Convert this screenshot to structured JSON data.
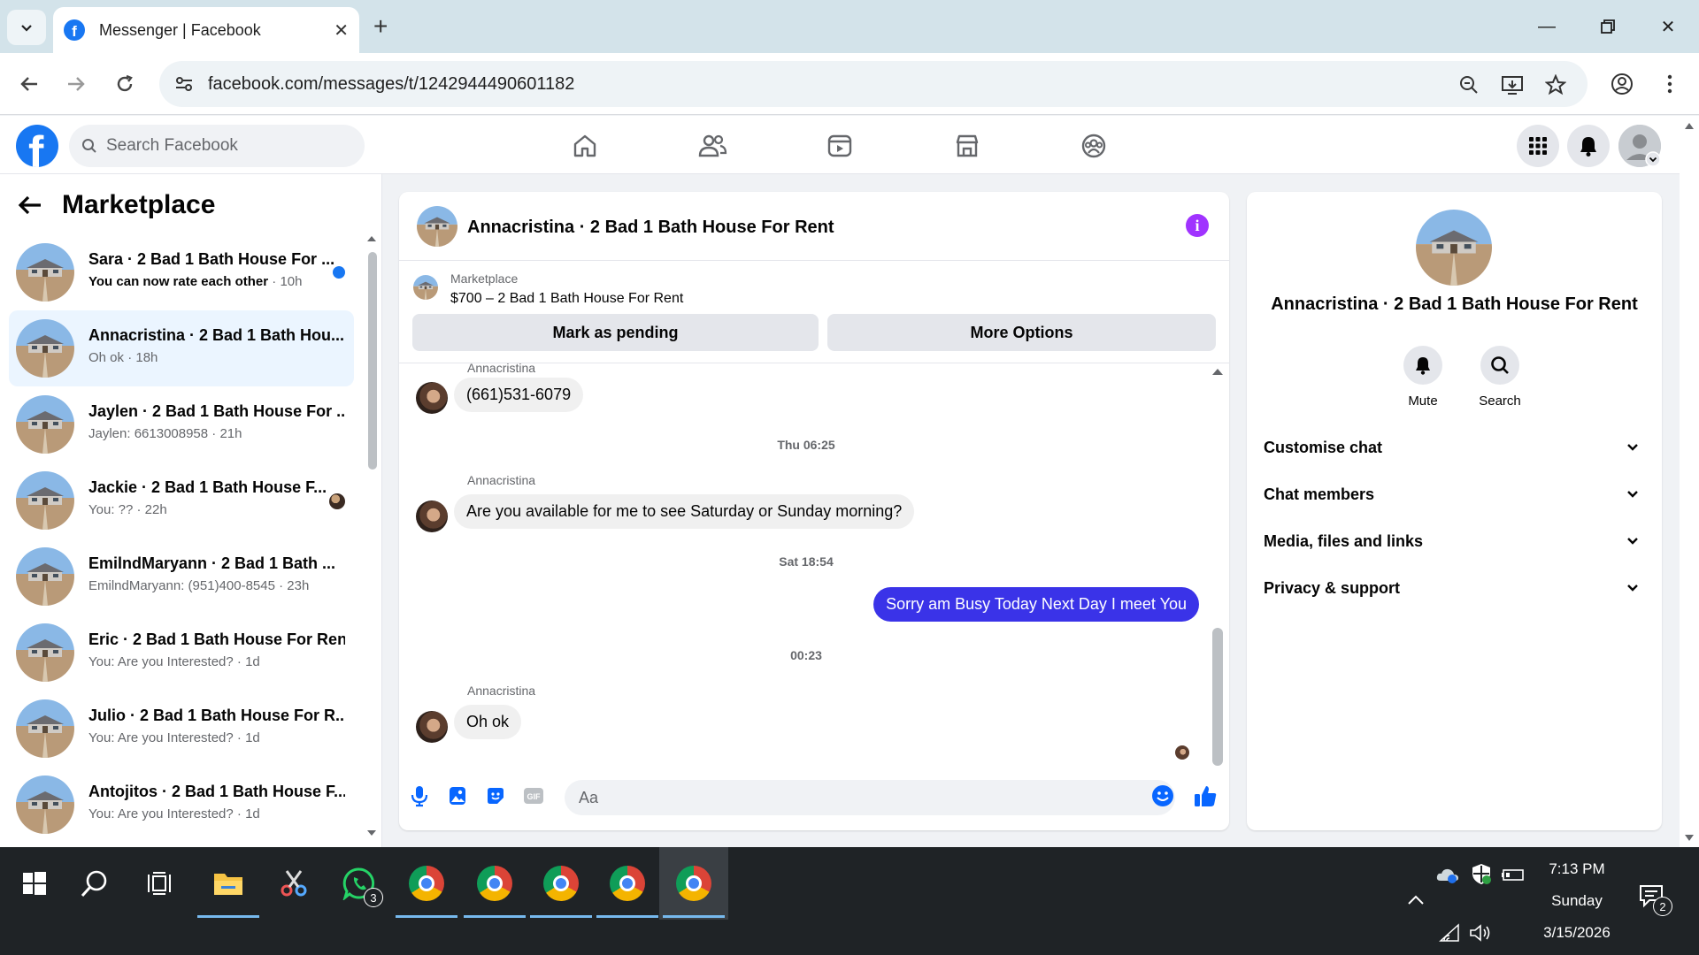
{
  "browser": {
    "tab_title": "Messenger | Facebook",
    "url": "facebook.com/messages/t/1242944490601182"
  },
  "fb": {
    "search_placeholder": "Search Facebook"
  },
  "sidebar": {
    "title": "Marketplace",
    "conversations": [
      {
        "name": "Sara · 2 Bad 1 Bath House For ...",
        "preview": "You can now rate each other",
        "time": " · 10h",
        "unread": true
      },
      {
        "name": "Annacristina · 2 Bad 1 Bath Hou...",
        "preview": "Oh ok",
        "time": " · 18h",
        "active": true
      },
      {
        "name": "Jaylen · 2 Bad 1 Bath House For ...",
        "preview": "Jaylen: 6613008958",
        "time": " · 21h"
      },
      {
        "name": "Jackie · 2 Bad 1 Bath House F...",
        "preview": "You: ??",
        "time": " · 22h"
      },
      {
        "name": "EmilndMaryann · 2 Bad 1 Bath ...",
        "preview": "EmilndMaryann: (951)400-8545",
        "time": " · 23h"
      },
      {
        "name": "Eric · 2 Bad 1 Bath House For Rent",
        "preview": "You: Are you Interested?",
        "time": " · 1d"
      },
      {
        "name": "Julio · 2 Bad 1 Bath House For R...",
        "preview": "You: Are you Interested?",
        "time": " · 1d"
      },
      {
        "name": "Antojitos · 2 Bad 1 Bath House F...",
        "preview": "You: Are you Interested?",
        "time": " · 1d"
      }
    ]
  },
  "chat": {
    "title": "Annacristina · 2 Bad 1 Bath House For Rent",
    "marketplace_label": "Marketplace",
    "listing": "$700 – 2 Bad 1 Bath House For Rent",
    "mark_pending": "Mark as pending",
    "more_options": "More Options",
    "sender_name": "Annacristina",
    "messages": {
      "m1": "(661)531-6079",
      "stamp1": "Thu 06:25",
      "m2": "Are you available for me to see Saturday or Sunday morning?",
      "stamp2": "Sat 18:54",
      "m3": "Sorry am Busy Today Next Day I meet You",
      "stamp3": "00:23",
      "m4": "Oh ok"
    },
    "composer_placeholder": "Aa"
  },
  "info": {
    "name": "Annacristina · 2 Bad 1 Bath House For Rent",
    "mute": "Mute",
    "search": "Search",
    "sections": [
      "Customise chat",
      "Chat members",
      "Media, files and links",
      "Privacy & support"
    ]
  },
  "taskbar": {
    "whatsapp_badge": "3",
    "time": "7:13 PM",
    "day": "Sunday",
    "date": "3/15/2026",
    "notif_badge": "2"
  },
  "colors": {
    "fb_blue": "#1877f2",
    "outgoing_bubble": "#3a33e8",
    "info_icon": "#a033ff"
  }
}
